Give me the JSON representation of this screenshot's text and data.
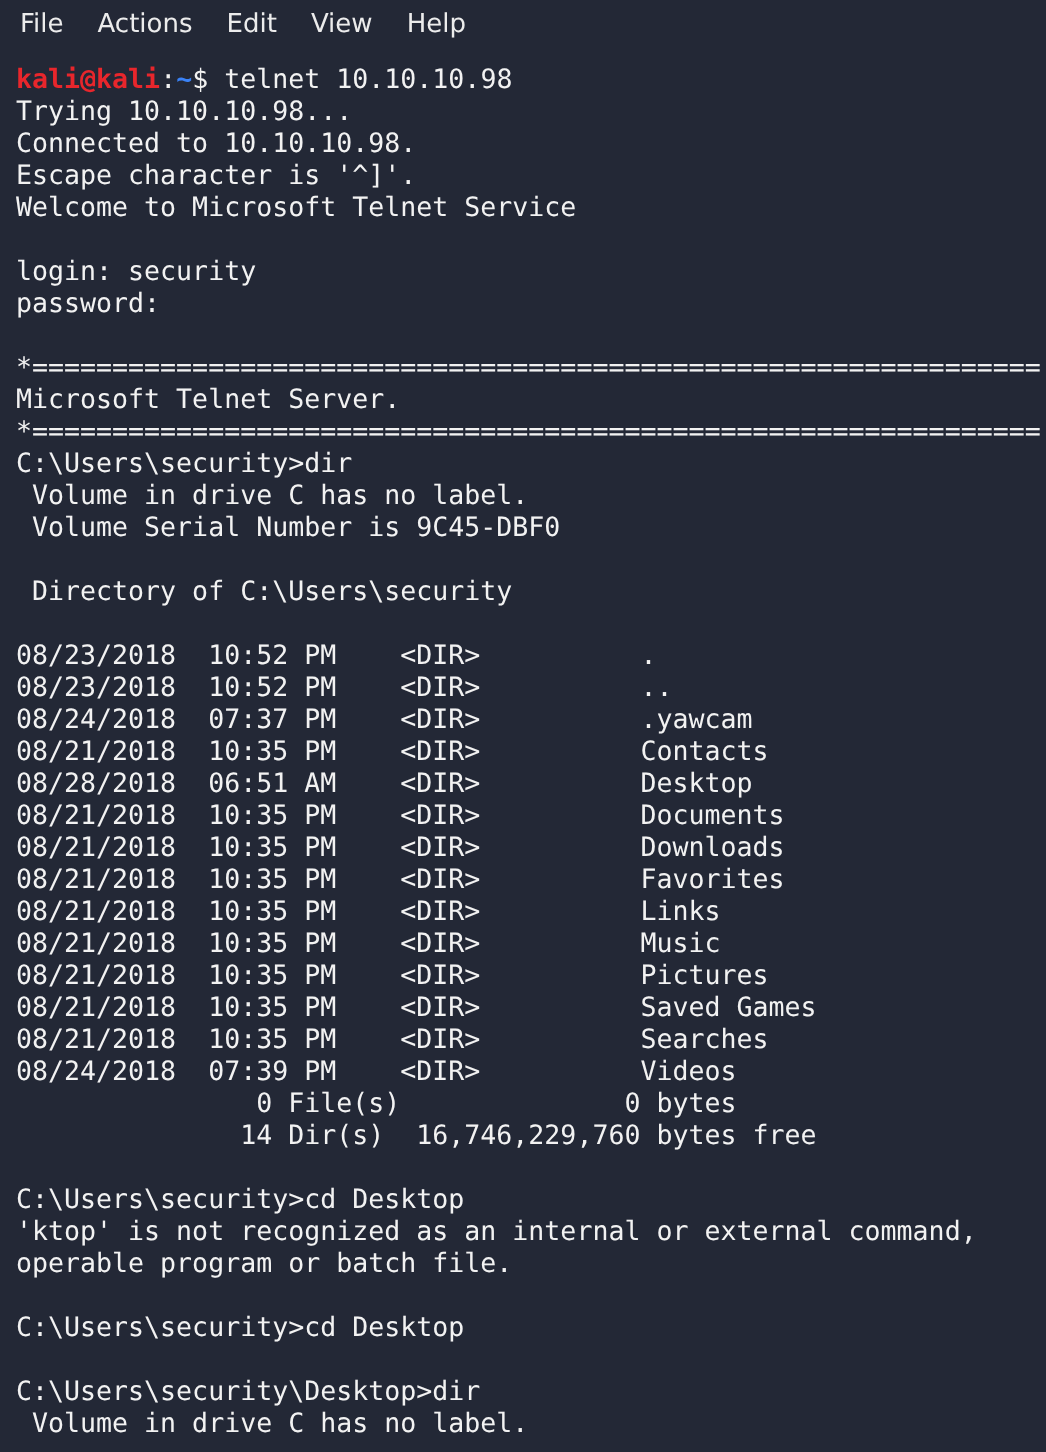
{
  "menu": [
    "File",
    "Actions",
    "Edit",
    "View",
    "Help"
  ],
  "lines": [
    {
      "kind": "prompt",
      "user_host": "kali@kali",
      "separator": ":",
      "cwd": "~",
      "command": "$ telnet 10.10.10.98"
    },
    {
      "kind": "output",
      "text": "Trying 10.10.10.98..."
    },
    {
      "kind": "output",
      "text": "Connected to 10.10.10.98."
    },
    {
      "kind": "output",
      "text": "Escape character is '^]'."
    },
    {
      "kind": "output",
      "text": "Welcome to Microsoft Telnet Service"
    },
    {
      "kind": "blank"
    },
    {
      "kind": "output",
      "text": "login: security"
    },
    {
      "kind": "output",
      "text": "password:"
    },
    {
      "kind": "blank"
    },
    {
      "kind": "output",
      "text": "*==============================================================="
    },
    {
      "kind": "output",
      "text": "Microsoft Telnet Server."
    },
    {
      "kind": "output",
      "text": "*==============================================================="
    },
    {
      "kind": "output",
      "text": "C:\\Users\\security>dir"
    },
    {
      "kind": "output",
      "text": " Volume in drive C has no label."
    },
    {
      "kind": "output",
      "text": " Volume Serial Number is 9C45-DBF0"
    },
    {
      "kind": "blank"
    },
    {
      "kind": "output",
      "text": " Directory of C:\\Users\\security"
    },
    {
      "kind": "blank"
    },
    {
      "kind": "output",
      "text": "08/23/2018  10:52 PM    <DIR>          ."
    },
    {
      "kind": "output",
      "text": "08/23/2018  10:52 PM    <DIR>          .."
    },
    {
      "kind": "output",
      "text": "08/24/2018  07:37 PM    <DIR>          .yawcam"
    },
    {
      "kind": "output",
      "text": "08/21/2018  10:35 PM    <DIR>          Contacts"
    },
    {
      "kind": "output",
      "text": "08/28/2018  06:51 AM    <DIR>          Desktop"
    },
    {
      "kind": "output",
      "text": "08/21/2018  10:35 PM    <DIR>          Documents"
    },
    {
      "kind": "output",
      "text": "08/21/2018  10:35 PM    <DIR>          Downloads"
    },
    {
      "kind": "output",
      "text": "08/21/2018  10:35 PM    <DIR>          Favorites"
    },
    {
      "kind": "output",
      "text": "08/21/2018  10:35 PM    <DIR>          Links"
    },
    {
      "kind": "output",
      "text": "08/21/2018  10:35 PM    <DIR>          Music"
    },
    {
      "kind": "output",
      "text": "08/21/2018  10:35 PM    <DIR>          Pictures"
    },
    {
      "kind": "output",
      "text": "08/21/2018  10:35 PM    <DIR>          Saved Games"
    },
    {
      "kind": "output",
      "text": "08/21/2018  10:35 PM    <DIR>          Searches"
    },
    {
      "kind": "output",
      "text": "08/24/2018  07:39 PM    <DIR>          Videos"
    },
    {
      "kind": "output",
      "text": "               0 File(s)              0 bytes"
    },
    {
      "kind": "output",
      "text": "              14 Dir(s)  16,746,229,760 bytes free"
    },
    {
      "kind": "blank"
    },
    {
      "kind": "output",
      "text": "C:\\Users\\security>cd Desktop"
    },
    {
      "kind": "output",
      "text": "'ktop' is not recognized as an internal or external command,"
    },
    {
      "kind": "output",
      "text": "operable program or batch file."
    },
    {
      "kind": "blank"
    },
    {
      "kind": "output",
      "text": "C:\\Users\\security>cd Desktop"
    },
    {
      "kind": "blank"
    },
    {
      "kind": "output",
      "text": "C:\\Users\\security\\Desktop>dir"
    },
    {
      "kind": "output",
      "text": " Volume in drive C has no label."
    }
  ]
}
